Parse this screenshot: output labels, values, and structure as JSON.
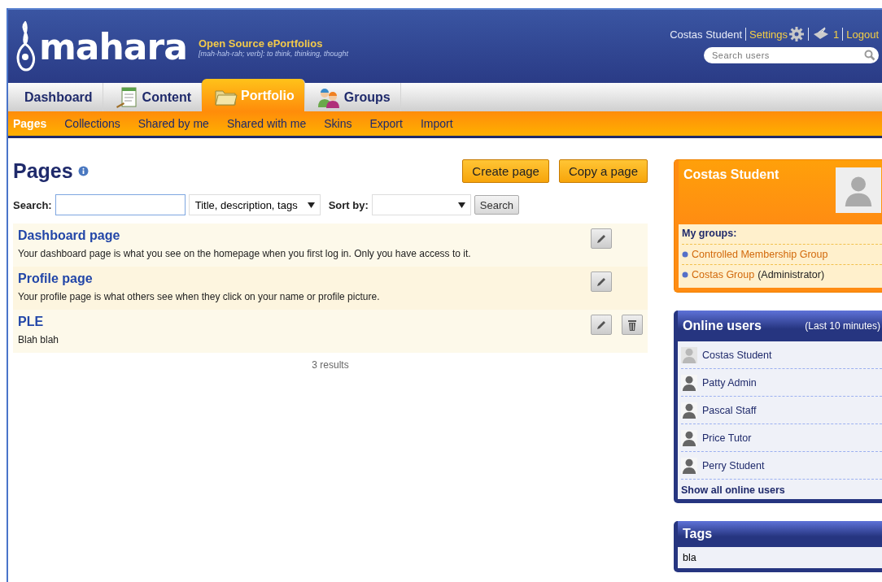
{
  "header": {
    "logo": "mahara",
    "tagline": "Open Source ePortfolios",
    "subtitle": "[mah-hah-rah; verb]: to think, thinking, thought",
    "user": "Costas Student",
    "settings": "Settings",
    "inbox_count": "1",
    "logout": "Logout",
    "search": {
      "placeholder": "Search users"
    }
  },
  "tabs": [
    {
      "label": "Dashboard",
      "selected": false
    },
    {
      "label": "Content",
      "selected": false
    },
    {
      "label": "Portfolio",
      "selected": true
    },
    {
      "label": "Groups",
      "selected": false
    }
  ],
  "subnav": [
    {
      "label": "Pages",
      "selected": true
    },
    {
      "label": "Collections",
      "selected": false
    },
    {
      "label": "Shared by me",
      "selected": false
    },
    {
      "label": "Shared with me",
      "selected": false
    },
    {
      "label": "Skins",
      "selected": false
    },
    {
      "label": "Export",
      "selected": false
    },
    {
      "label": "Import",
      "selected": false
    }
  ],
  "main": {
    "title": "Pages",
    "buttons": [
      "Create page",
      "Copy a page"
    ],
    "search": {
      "label": "Search:",
      "scope": "Title, description, tags",
      "sort_label": "Sort by:",
      "button": "Search"
    },
    "pages": [
      {
        "title": "Dashboard page",
        "description": "Your dashboard page is what you see on the homepage when you first log in. Only you have access to it.",
        "deletable": false
      },
      {
        "title": "Profile page",
        "description": "Your profile page is what others see when they click on your name or profile picture.",
        "deletable": false
      },
      {
        "title": "PLE",
        "description": "Blah blah",
        "deletable": true
      }
    ],
    "results": "3 results"
  },
  "sidebar": {
    "profile": {
      "name": "Costas Student",
      "groups_label": "My groups:",
      "groups": [
        {
          "name": "Controlled Membership Group"
        },
        {
          "name": "Costas Group",
          "role": "(Administrator)"
        }
      ]
    },
    "online": {
      "title": "Online users",
      "note": "(Last 10 minutes)",
      "users": [
        {
          "name": "Costas Student",
          "self": true
        },
        {
          "name": "Patty Admin",
          "self": false
        },
        {
          "name": "Pascal Staff",
          "self": false
        },
        {
          "name": "Price Tutor",
          "self": false
        },
        {
          "name": "Perry Student",
          "self": false
        }
      ],
      "show_all": "Show all online users"
    },
    "tags": {
      "title": "Tags",
      "items": [
        "bla"
      ]
    }
  }
}
